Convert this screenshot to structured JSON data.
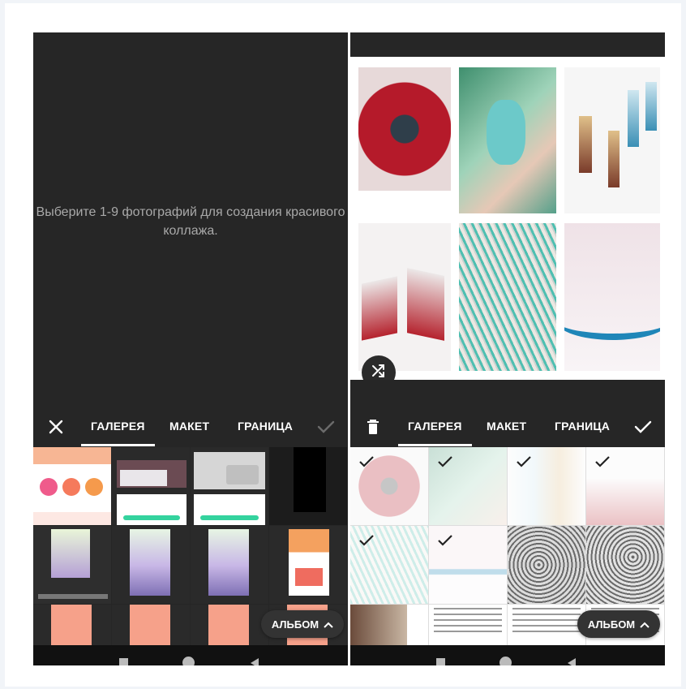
{
  "left_screen": {
    "empty_message": "Выберите 1-9 фотографий для создания красивого коллажа.",
    "toolbar": {
      "close_icon": "close-icon",
      "tabs": [
        "ГАЛЕРЕЯ",
        "МАКЕТ",
        "ГРАНИЦА"
      ],
      "active_tab": "ГАЛЕРЕЯ",
      "confirm_icon": "check-icon",
      "confirm_enabled": false
    },
    "album_button": {
      "label": "АЛЬБОМ",
      "icon": "chevron-up-icon"
    }
  },
  "right_screen": {
    "selected_count": 6,
    "shuffle_icon": "shuffle-icon",
    "toolbar": {
      "delete_icon": "trash-icon",
      "tabs": [
        "ГАЛЕРЕЯ",
        "МАКЕТ",
        "ГРАНИЦА"
      ],
      "active_tab": "ГАЛЕРЕЯ",
      "confirm_icon": "check-icon",
      "confirm_enabled": true
    },
    "album_button": {
      "label": "АЛЬБОМ",
      "icon": "chevron-up-icon"
    }
  },
  "colors": {
    "dark_bg": "#262626",
    "accent_white": "#ffffff",
    "disabled_icon": "#6b6b6b"
  }
}
